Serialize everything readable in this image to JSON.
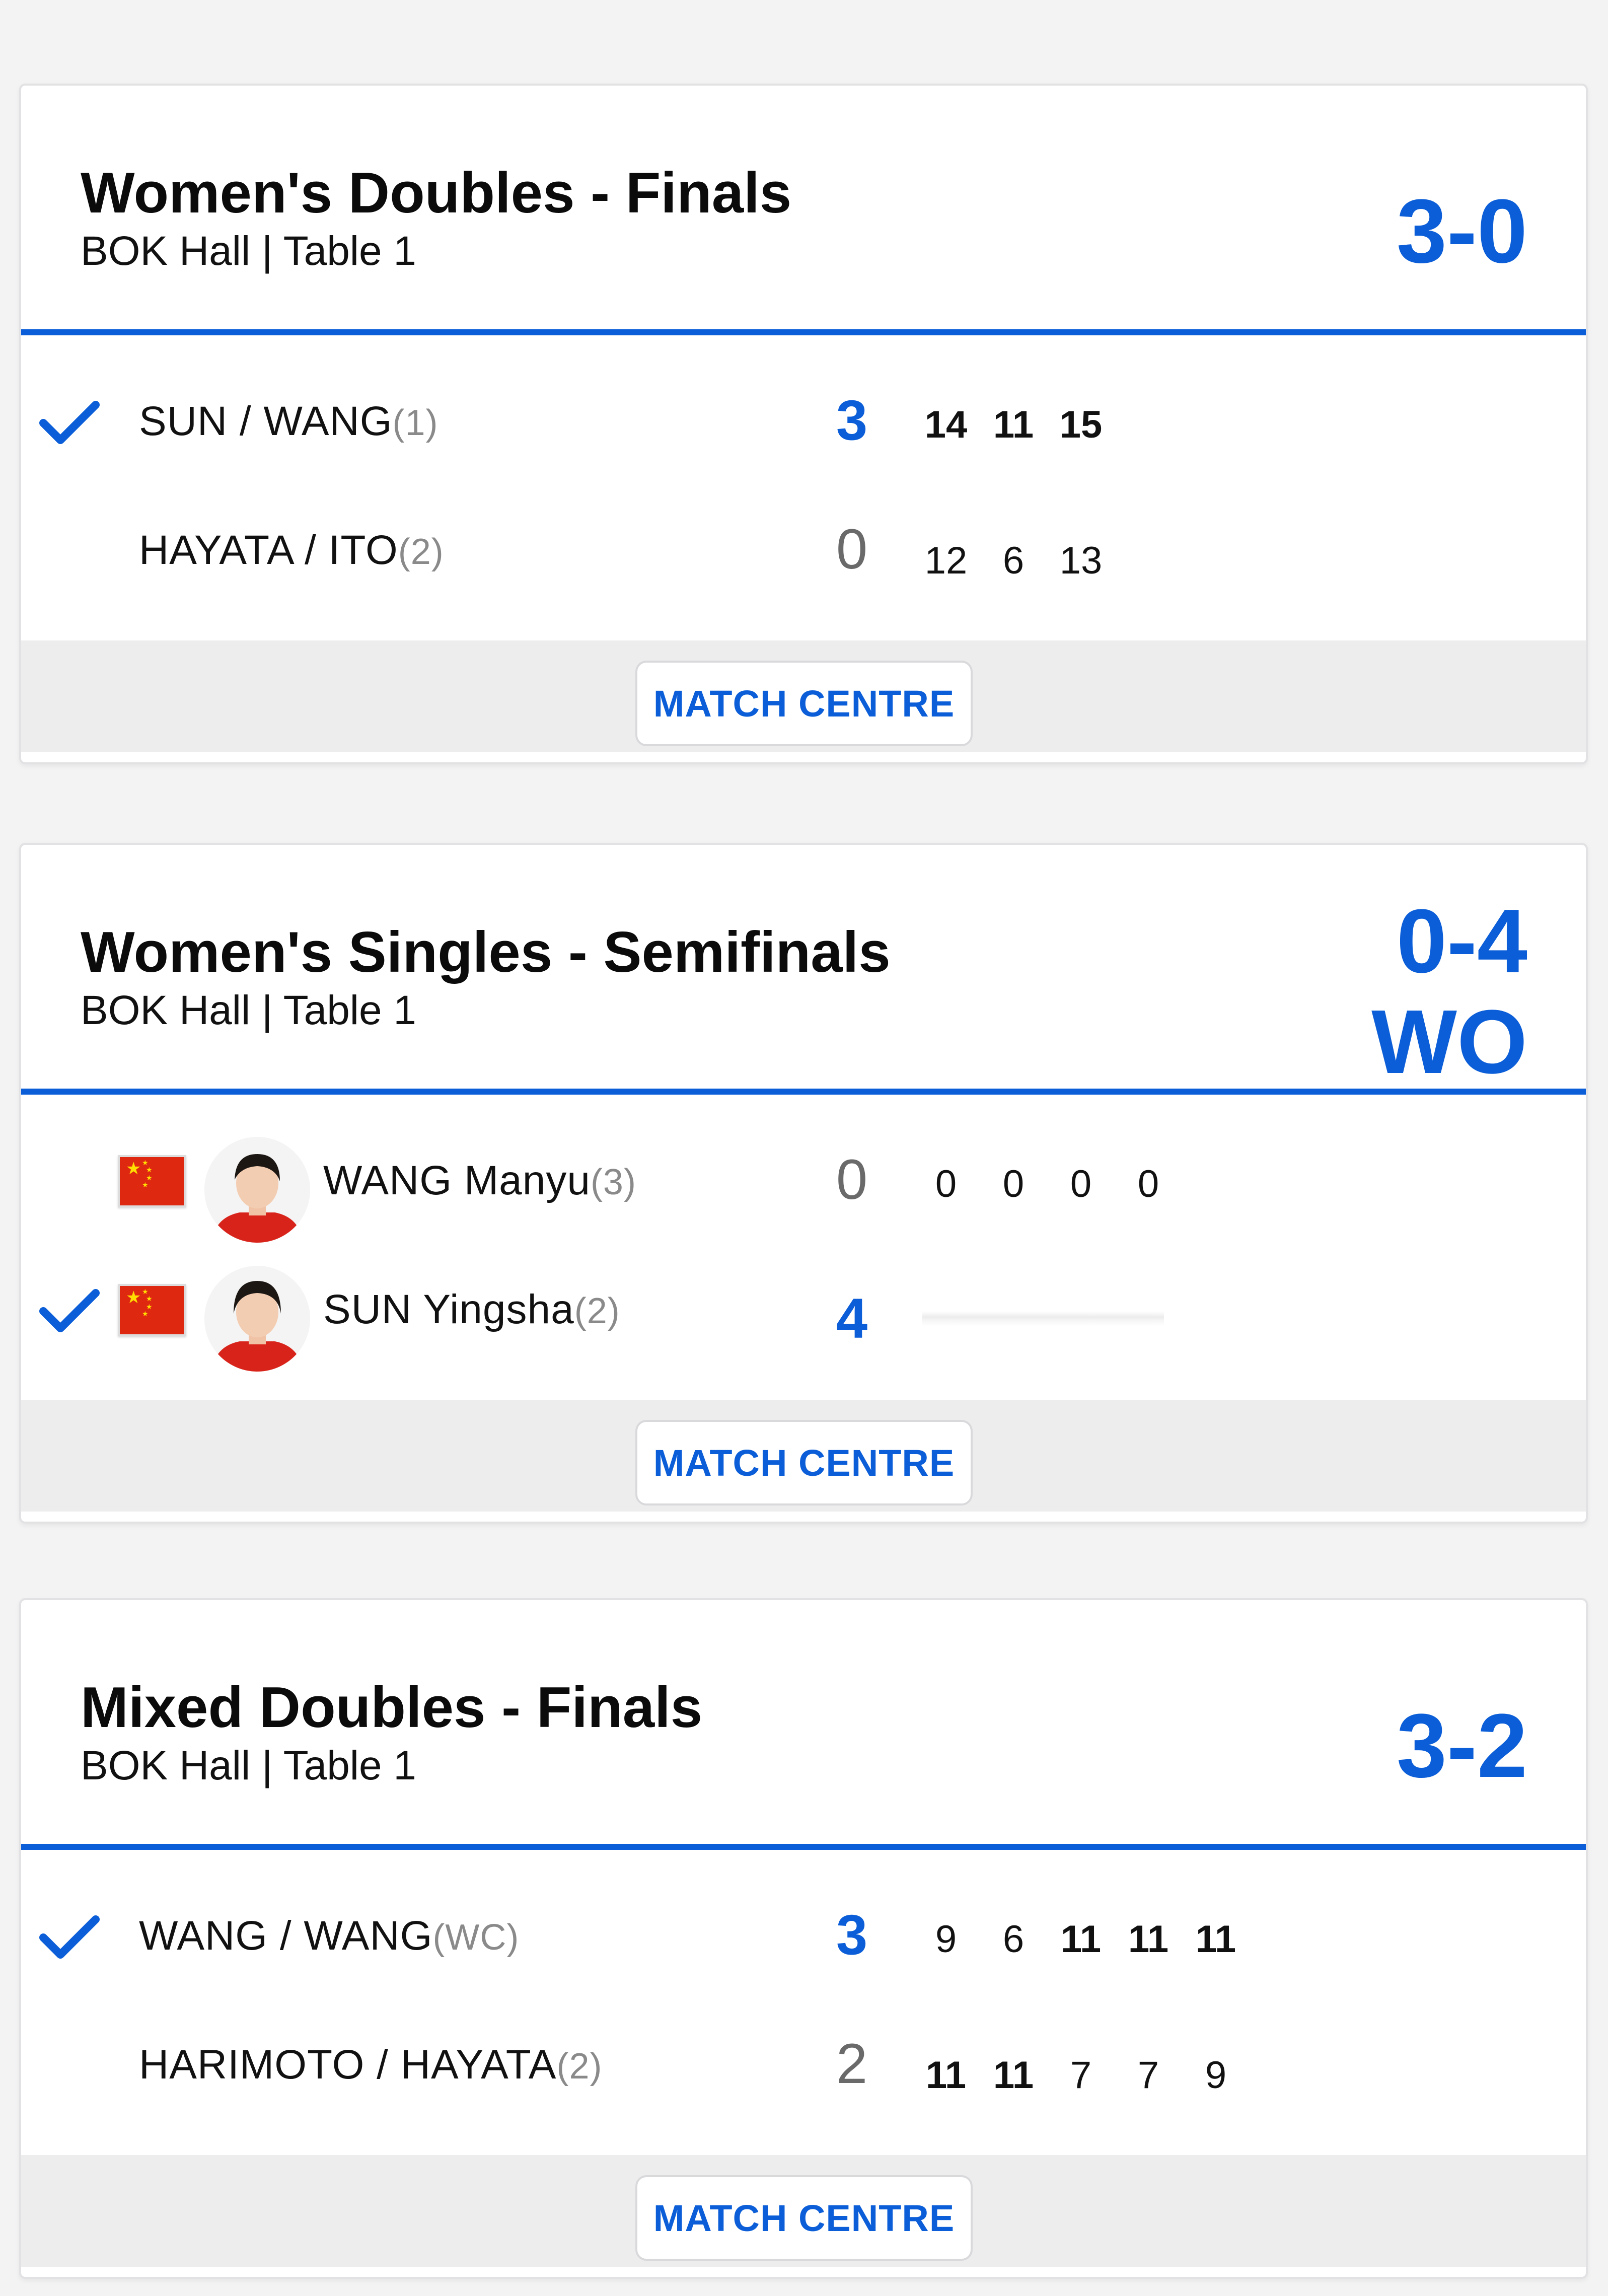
{
  "matches": [
    {
      "title": "Women's Doubles - Finals",
      "venue": "BOK Hall | Table 1",
      "score_lines": [
        "3-0"
      ],
      "players": [
        {
          "name": "SUN / WANG",
          "seed": "(1)",
          "winner": true,
          "score": "3",
          "games": [
            {
              "v": "14",
              "win": true
            },
            {
              "v": "11",
              "win": true
            },
            {
              "v": "15",
              "win": true
            }
          ]
        },
        {
          "name": "HAYATA / ITO",
          "seed": "(2)",
          "winner": false,
          "score": "0",
          "games": [
            {
              "v": "12",
              "win": false
            },
            {
              "v": "6",
              "win": false
            },
            {
              "v": "13",
              "win": false
            }
          ]
        }
      ],
      "button": "MATCH CENTRE"
    },
    {
      "title": "Women's Singles - Semifinals",
      "venue": "BOK Hall | Table 1",
      "score_lines": [
        "0-4",
        "WO"
      ],
      "players": [
        {
          "name": "WANG Manyu",
          "seed": "(3)",
          "winner": false,
          "score": "0",
          "flag": "china-flag",
          "photo": "player-photo",
          "games": [
            {
              "v": "0",
              "win": false
            },
            {
              "v": "0",
              "win": false
            },
            {
              "v": "0",
              "win": false
            },
            {
              "v": "0",
              "win": false
            }
          ]
        },
        {
          "name": "SUN Yingsha",
          "seed": "(2)",
          "winner": true,
          "score": "4",
          "flag": "china-flag",
          "photo": "player-photo",
          "games": []
        }
      ],
      "button": "MATCH CENTRE"
    },
    {
      "title": "Mixed Doubles - Finals",
      "venue": "BOK Hall | Table 1",
      "score_lines": [
        "3-2"
      ],
      "players": [
        {
          "name": "WANG / WANG",
          "seed": "(WC)",
          "winner": true,
          "score": "3",
          "games": [
            {
              "v": "9",
              "win": false
            },
            {
              "v": "6",
              "win": false
            },
            {
              "v": "11",
              "win": true
            },
            {
              "v": "11",
              "win": true
            },
            {
              "v": "11",
              "win": true
            }
          ]
        },
        {
          "name": "HARIMOTO / HAYATA",
          "seed": "(2)",
          "winner": false,
          "score": "2",
          "games": [
            {
              "v": "11",
              "win": true
            },
            {
              "v": "11",
              "win": true
            },
            {
              "v": "7",
              "win": false
            },
            {
              "v": "7",
              "win": false
            },
            {
              "v": "9",
              "win": false
            }
          ]
        }
      ],
      "button": "MATCH CENTRE"
    }
  ],
  "colors": {
    "accent": "#0b5ed8",
    "flag_red": "#de2910",
    "flag_star": "#ffde00"
  }
}
